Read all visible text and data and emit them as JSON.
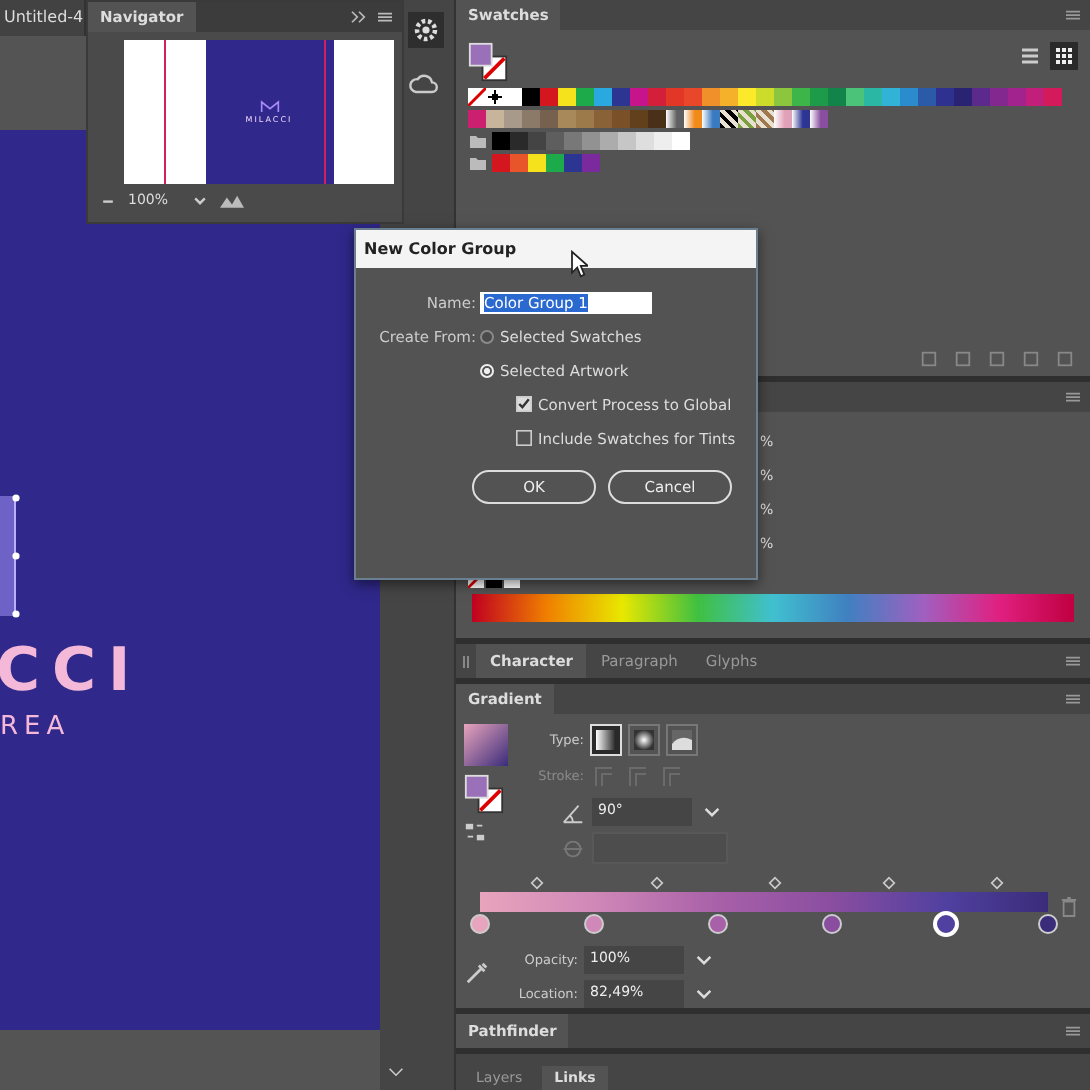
{
  "document_tab": {
    "title": "Untitled-4"
  },
  "navigator": {
    "title": "Navigator",
    "thumbnail_text": "MILACCI",
    "zoom": "100%"
  },
  "canvas": {
    "logo_text": "CCI",
    "tagline": "REA"
  },
  "swatches": {
    "title": "Swatches",
    "view_modes": [
      {
        "kind": "list",
        "selected": false
      },
      {
        "kind": "grid",
        "selected": true
      }
    ],
    "rows": [
      {
        "kind": "plain",
        "swatches": [
          {
            "kind": "none",
            "color": "#ffffff"
          },
          {
            "kind": "registration",
            "color": "#000000"
          },
          {
            "kind": "color",
            "color": "#ffffff"
          },
          {
            "kind": "color",
            "color": "#000000"
          },
          {
            "kind": "color",
            "color": "#d4161e"
          },
          {
            "kind": "color",
            "color": "#f6e21c"
          },
          {
            "kind": "color",
            "color": "#1daa4a"
          },
          {
            "kind": "color",
            "color": "#2aa9e0"
          },
          {
            "kind": "color",
            "color": "#2c3592"
          },
          {
            "kind": "color",
            "color": "#c6158b"
          },
          {
            "kind": "color",
            "color": "#d41f3b"
          },
          {
            "kind": "color",
            "color": "#e23726"
          },
          {
            "kind": "color",
            "color": "#e8472a"
          },
          {
            "kind": "color",
            "color": "#f0902a"
          },
          {
            "kind": "color",
            "color": "#f6b12a"
          },
          {
            "kind": "color",
            "color": "#fbe92a"
          },
          {
            "kind": "color",
            "color": "#cddc2a"
          },
          {
            "kind": "color",
            "color": "#8cc63e"
          },
          {
            "kind": "color",
            "color": "#3eb549"
          },
          {
            "kind": "color",
            "color": "#1e9b48"
          },
          {
            "kind": "color",
            "color": "#12844a"
          },
          {
            "kind": "color",
            "color": "#4bc47a"
          },
          {
            "kind": "color",
            "color": "#2ab7a4"
          },
          {
            "kind": "color",
            "color": "#30b3d6"
          },
          {
            "kind": "color",
            "color": "#2a8ccc"
          },
          {
            "kind": "color",
            "color": "#2a5aa8"
          },
          {
            "kind": "color",
            "color": "#2e3190"
          },
          {
            "kind": "color",
            "color": "#2a2272"
          },
          {
            "kind": "color",
            "color": "#5c2a8c"
          },
          {
            "kind": "color",
            "color": "#83288f"
          },
          {
            "kind": "color",
            "color": "#a2238e"
          },
          {
            "kind": "color",
            "color": "#c11f7a"
          },
          {
            "kind": "color",
            "color": "#d41a5a"
          }
        ]
      },
      {
        "kind": "plain",
        "swatches": [
          {
            "kind": "color",
            "color": "#cc1f6f"
          },
          {
            "kind": "color",
            "color": "#c8b49a"
          },
          {
            "kind": "color",
            "color": "#a89a8a"
          },
          {
            "kind": "color",
            "color": "#8c7a68"
          },
          {
            "kind": "color",
            "color": "#76604e"
          },
          {
            "kind": "color",
            "color": "#a88a5a"
          },
          {
            "kind": "color",
            "color": "#9c7a4a"
          },
          {
            "kind": "color",
            "color": "#8a6238"
          },
          {
            "kind": "color",
            "color": "#7a5028"
          },
          {
            "kind": "color",
            "color": "#62401c"
          },
          {
            "kind": "color",
            "color": "#4a3018"
          },
          {
            "kind": "gradient",
            "color": "#606060"
          },
          {
            "kind": "gradient",
            "color": "#f08a1c"
          },
          {
            "kind": "gradient",
            "color": "#3a7ac0"
          },
          {
            "kind": "pattern",
            "color": "#000000"
          },
          {
            "kind": "pattern",
            "color": "#7aa040"
          },
          {
            "kind": "pattern",
            "color": "#a07850"
          },
          {
            "kind": "gradient",
            "color": "#e0a0b8"
          },
          {
            "kind": "gradient",
            "color": "#2c3592"
          },
          {
            "kind": "gradient",
            "color": "#8a4ea0"
          }
        ]
      },
      {
        "kind": "group",
        "swatches": [
          {
            "kind": "color",
            "color": "#000000"
          },
          {
            "kind": "color",
            "color": "#2a2a2a"
          },
          {
            "kind": "color",
            "color": "#444444"
          },
          {
            "kind": "color",
            "color": "#5e5e5e"
          },
          {
            "kind": "color",
            "color": "#787878"
          },
          {
            "kind": "color",
            "color": "#929292"
          },
          {
            "kind": "color",
            "color": "#acacac"
          },
          {
            "kind": "color",
            "color": "#c6c6c6"
          },
          {
            "kind": "color",
            "color": "#dedede"
          },
          {
            "kind": "color",
            "color": "#eeeeee"
          },
          {
            "kind": "color",
            "color": "#ffffff"
          }
        ]
      },
      {
        "kind": "group",
        "swatches": [
          {
            "kind": "color",
            "color": "#d4161e"
          },
          {
            "kind": "color",
            "color": "#e8552a"
          },
          {
            "kind": "color",
            "color": "#f6e21c"
          },
          {
            "kind": "color",
            "color": "#1daa4a"
          },
          {
            "kind": "color",
            "color": "#2c3592"
          },
          {
            "kind": "color",
            "color": "#7a2a9c"
          }
        ]
      }
    ]
  },
  "color_panel": {
    "percent_labels": [
      "%",
      "%",
      "%",
      "%"
    ]
  },
  "character_tabs": [
    {
      "label": "Character",
      "selected": true
    },
    {
      "label": "Paragraph",
      "selected": false
    },
    {
      "label": "Glyphs",
      "selected": false
    }
  ],
  "gradient": {
    "title": "Gradient",
    "type_label": "Type:",
    "types": [
      {
        "kind": "linear",
        "selected": true
      },
      {
        "kind": "radial",
        "selected": false
      },
      {
        "kind": "freeform",
        "selected": false
      }
    ],
    "stroke_label": "Stroke:",
    "stroke_disabled": true,
    "angle": "90°",
    "opacity_label": "Opacity:",
    "opacity": "100%",
    "location_label": "Location:",
    "location": "82,49%",
    "stops": [
      {
        "color": "#e8a4bc",
        "level": 0,
        "selected": false
      },
      {
        "color": "#d088b8",
        "level": 0.2,
        "selected": false
      },
      {
        "color": "#a860a8",
        "level": 0.42,
        "selected": false
      },
      {
        "color": "#8a4ea0",
        "level": 0.62,
        "selected": false
      },
      {
        "color": "#5040a0",
        "level": 0.82,
        "selected": true
      },
      {
        "color": "#3a2c7a",
        "level": 1,
        "selected": false
      }
    ]
  },
  "pathfinder": {
    "title": "Pathfinder"
  },
  "bottom_tabs": [
    {
      "label": "Layers",
      "selected": false
    },
    {
      "label": "Links",
      "selected": true
    }
  ],
  "dialog": {
    "title": "New Color Group",
    "name_label": "Name:",
    "name_value": "Color Group 1",
    "create_label": "Create From:",
    "sources": [
      {
        "label": "Selected Swatches",
        "selected": false
      },
      {
        "label": "Selected Artwork",
        "selected": true
      }
    ],
    "options": [
      {
        "label": "Convert Process to Global",
        "checked": true
      },
      {
        "label": "Include Swatches for Tints",
        "checked": false
      }
    ],
    "buttons": [
      "OK",
      "Cancel"
    ]
  }
}
